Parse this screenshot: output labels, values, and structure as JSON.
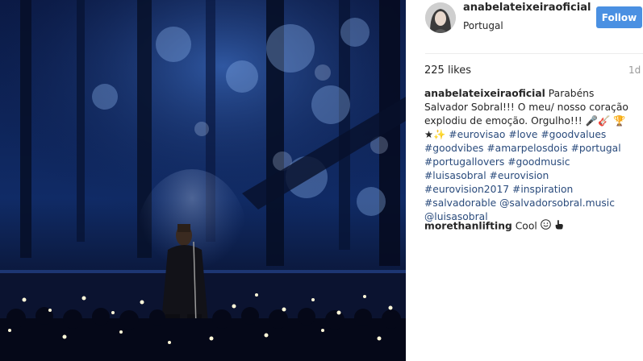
{
  "post": {
    "username": "anabelateixeiraoficial",
    "location": "Portugal",
    "follow_label": "Follow",
    "likes": "225 likes",
    "time": "1d"
  },
  "caption": {
    "username": "anabelateixeiraoficial",
    "text": "Parabéns Salvador Sobral!!! O meu/ nosso coração explodiu de emoção. Orgulho!!!",
    "hashtags": [
      "#eurovisao",
      "#love",
      "#goodvalues",
      "#goodvibes",
      "#amarpelosdois",
      "#portugal",
      "#portugallovers",
      "#goodmusic",
      "#luisasobral",
      "#eurovision",
      "#eurovision2017",
      "#inspiration",
      "#salvadorable"
    ],
    "mentions": [
      "@salvadorsobral.music",
      "@luisasobral"
    ]
  },
  "comment": {
    "username": "morethanlifting",
    "text": "Cool"
  },
  "icons": [
    "microphone-icon",
    "guitar-icon",
    "trophy-icon",
    "star-icon",
    "sparkles-icon",
    "smile-icon",
    "pointing-hand-icon"
  ],
  "colors": {
    "follow_button": "#4a90e2",
    "hashtag": "#2a4b7c",
    "stage_blue": "#0a1535"
  }
}
